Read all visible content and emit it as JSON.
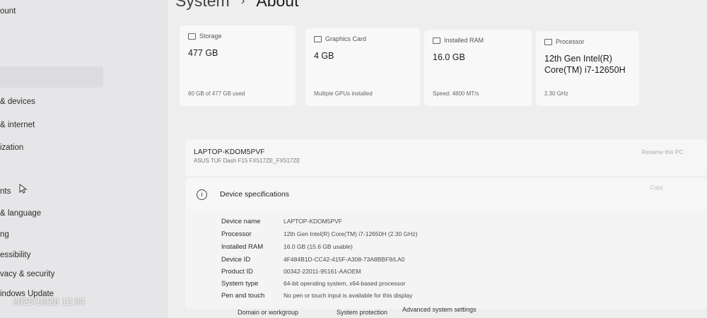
{
  "sidebar": {
    "items": [
      {
        "label": "ount"
      },
      {
        "label": "& devices"
      },
      {
        "label": "& internet"
      },
      {
        "label": "ization"
      },
      {
        "label": "nts"
      },
      {
        "label": "& language"
      },
      {
        "label": "ng"
      },
      {
        "label": "essibility"
      },
      {
        "label": "vacy & security"
      },
      {
        "label": "indows Update"
      }
    ]
  },
  "breadcrumb": {
    "parent": "System",
    "separator": "›",
    "current": "About"
  },
  "cards": [
    {
      "label": "Storage",
      "value": "477 GB",
      "sub": "60 GB of 477 GB used"
    },
    {
      "label": "Graphics Card",
      "value": "4 GB",
      "sub": "Multiple GPUs installed"
    },
    {
      "label": "Installed RAM",
      "value": "16.0 GB",
      "sub": "Speed: 4800 MT/s"
    },
    {
      "label": "Processor",
      "value": "12th Gen Intel(R) Core(TM) i7-12650H",
      "sub": "2.30 GHz"
    }
  ],
  "device": {
    "name": "LAPTOP-KDOM5PVF",
    "model": "ASUS TUF Dash F15 FX517ZE_FX517ZE",
    "rename_label": "Rename this PC"
  },
  "specs": {
    "title": "Device specifications",
    "copy_label": "Copy",
    "rows": [
      {
        "key": "Device name",
        "value": "LAPTOP-KDOM5PVF"
      },
      {
        "key": "Processor",
        "value": "12th Gen Intel(R) Core(TM) i7-12650H (2.30 GHz)"
      },
      {
        "key": "Installed RAM",
        "value": "16.0 GB (15.6 GB usable)"
      },
      {
        "key": "Device ID",
        "value": "4F484B1D-CC42-415F-A308-73A8BBF9/LA0"
      },
      {
        "key": "Product ID",
        "value": "00342-22011-95161-AAOEM"
      },
      {
        "key": "System type",
        "value": "64-bit operating system, x64-based processor"
      },
      {
        "key": "Pen and touch",
        "value": "No pen or touch input is available for this display"
      }
    ]
  },
  "related_links": [
    {
      "label": "Domain or workgroup"
    },
    {
      "label": "System protection"
    },
    {
      "label": "Advanced system settings"
    }
  ],
  "timestamp": "2025/10/28 12:34"
}
